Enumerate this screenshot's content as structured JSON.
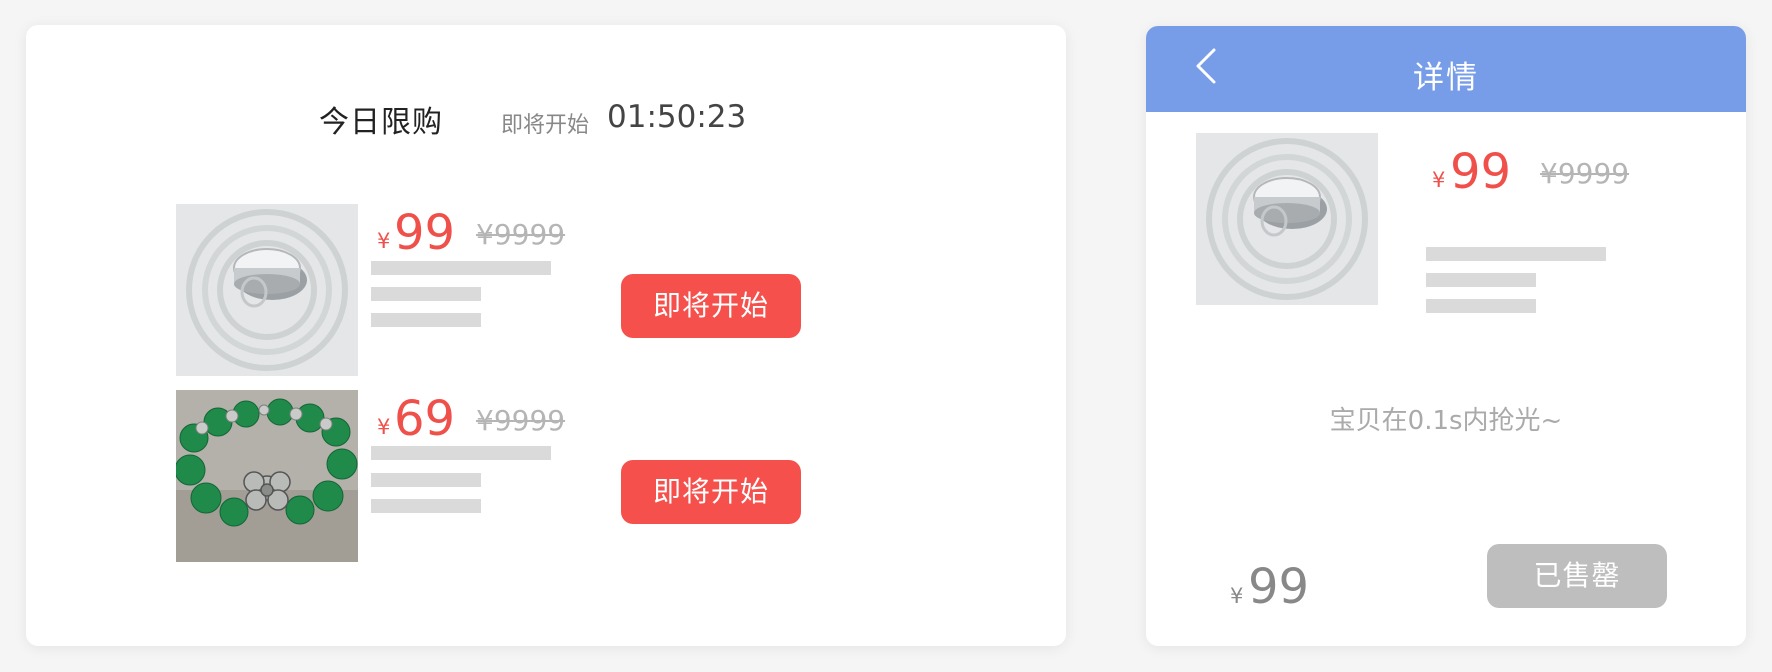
{
  "flash_sale": {
    "title": "今日限购",
    "countdown_label": "即将开始",
    "countdown_time": "01:50:23",
    "products": [
      {
        "image": "cushion-compact-image",
        "currency": "¥",
        "price": "99",
        "original_price": "¥9999",
        "button_label": "即将开始"
      },
      {
        "image": "jade-bracelet-image",
        "currency": "¥",
        "price": "69",
        "original_price": "¥9999",
        "button_label": "即将开始"
      }
    ]
  },
  "detail": {
    "title": "详情",
    "back_icon": "chevron-left-icon",
    "product": {
      "image": "cushion-compact-image",
      "currency": "¥",
      "price": "99",
      "original_price": "¥9999"
    },
    "message": "宝贝在0.1s内抢光~",
    "bottom_currency": "¥",
    "bottom_price": "99",
    "sold_out_label": "已售罄"
  },
  "colors": {
    "accent_red": "#f5504c",
    "header_blue": "#779de9",
    "disabled_gray": "#bebebe",
    "placeholder_bar": "#dadada"
  }
}
